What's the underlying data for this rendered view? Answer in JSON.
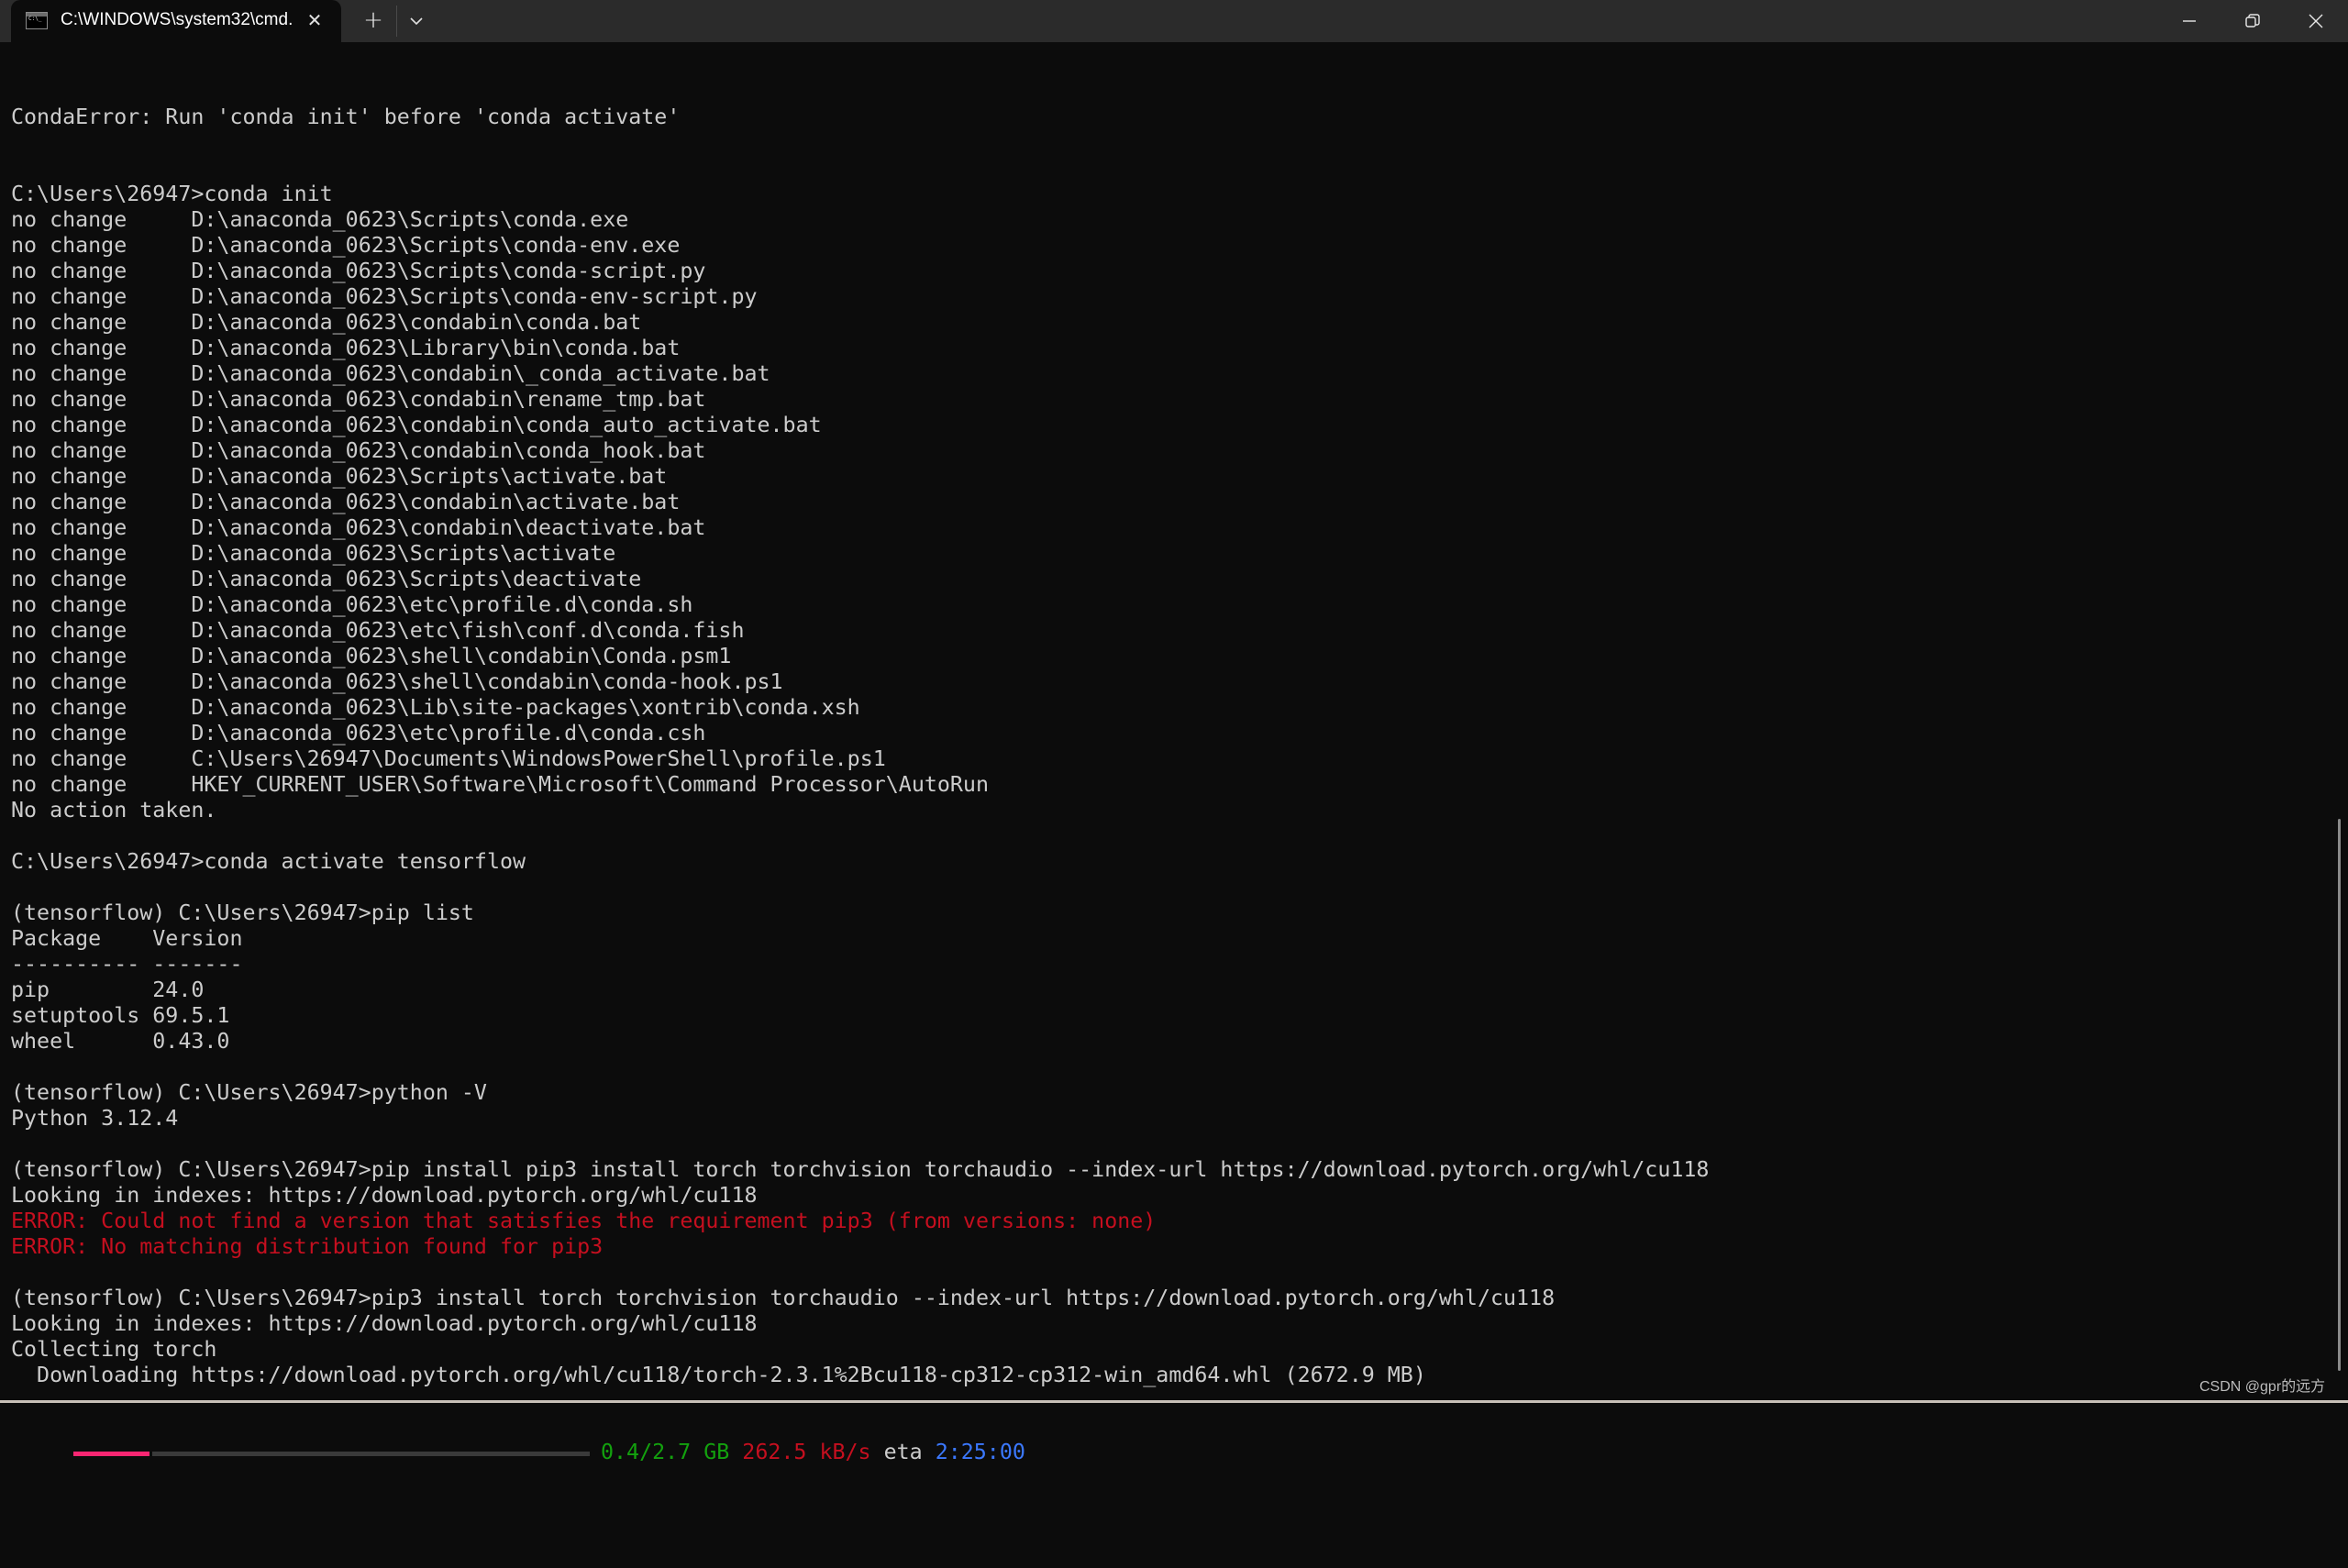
{
  "window": {
    "tab_title": "C:\\WINDOWS\\system32\\cmd.",
    "tab_close": "✕",
    "new_tab": "+",
    "tab_icon": "cmd-icon",
    "controls": [
      "minimize",
      "restore",
      "close"
    ]
  },
  "terminal": {
    "lines": [
      {
        "text": "CondaError: Run 'conda init' before 'conda activate'",
        "type": "normal"
      },
      {
        "text": "",
        "type": "normal"
      },
      {
        "text": "",
        "type": "normal"
      },
      {
        "text": "C:\\Users\\26947>conda init",
        "type": "normal"
      },
      {
        "text": "no change     D:\\anaconda_0623\\Scripts\\conda.exe",
        "type": "normal"
      },
      {
        "text": "no change     D:\\anaconda_0623\\Scripts\\conda-env.exe",
        "type": "normal"
      },
      {
        "text": "no change     D:\\anaconda_0623\\Scripts\\conda-script.py",
        "type": "normal"
      },
      {
        "text": "no change     D:\\anaconda_0623\\Scripts\\conda-env-script.py",
        "type": "normal"
      },
      {
        "text": "no change     D:\\anaconda_0623\\condabin\\conda.bat",
        "type": "normal"
      },
      {
        "text": "no change     D:\\anaconda_0623\\Library\\bin\\conda.bat",
        "type": "normal"
      },
      {
        "text": "no change     D:\\anaconda_0623\\condabin\\_conda_activate.bat",
        "type": "normal"
      },
      {
        "text": "no change     D:\\anaconda_0623\\condabin\\rename_tmp.bat",
        "type": "normal"
      },
      {
        "text": "no change     D:\\anaconda_0623\\condabin\\conda_auto_activate.bat",
        "type": "normal"
      },
      {
        "text": "no change     D:\\anaconda_0623\\condabin\\conda_hook.bat",
        "type": "normal"
      },
      {
        "text": "no change     D:\\anaconda_0623\\Scripts\\activate.bat",
        "type": "normal"
      },
      {
        "text": "no change     D:\\anaconda_0623\\condabin\\activate.bat",
        "type": "normal"
      },
      {
        "text": "no change     D:\\anaconda_0623\\condabin\\deactivate.bat",
        "type": "normal"
      },
      {
        "text": "no change     D:\\anaconda_0623\\Scripts\\activate",
        "type": "normal"
      },
      {
        "text": "no change     D:\\anaconda_0623\\Scripts\\deactivate",
        "type": "normal"
      },
      {
        "text": "no change     D:\\anaconda_0623\\etc\\profile.d\\conda.sh",
        "type": "normal"
      },
      {
        "text": "no change     D:\\anaconda_0623\\etc\\fish\\conf.d\\conda.fish",
        "type": "normal"
      },
      {
        "text": "no change     D:\\anaconda_0623\\shell\\condabin\\Conda.psm1",
        "type": "normal"
      },
      {
        "text": "no change     D:\\anaconda_0623\\shell\\condabin\\conda-hook.ps1",
        "type": "normal"
      },
      {
        "text": "no change     D:\\anaconda_0623\\Lib\\site-packages\\xontrib\\conda.xsh",
        "type": "normal"
      },
      {
        "text": "no change     D:\\anaconda_0623\\etc\\profile.d\\conda.csh",
        "type": "normal"
      },
      {
        "text": "no change     C:\\Users\\26947\\Documents\\WindowsPowerShell\\profile.ps1",
        "type": "normal"
      },
      {
        "text": "no change     HKEY_CURRENT_USER\\Software\\Microsoft\\Command Processor\\AutoRun",
        "type": "normal"
      },
      {
        "text": "No action taken.",
        "type": "normal"
      },
      {
        "text": "",
        "type": "normal"
      },
      {
        "text": "C:\\Users\\26947>conda activate tensorflow",
        "type": "normal"
      },
      {
        "text": "",
        "type": "normal"
      },
      {
        "text": "(tensorflow) C:\\Users\\26947>pip list",
        "type": "normal"
      },
      {
        "text": "Package    Version",
        "type": "normal"
      },
      {
        "text": "---------- -------",
        "type": "normal"
      },
      {
        "text": "pip        24.0",
        "type": "normal"
      },
      {
        "text": "setuptools 69.5.1",
        "type": "normal"
      },
      {
        "text": "wheel      0.43.0",
        "type": "normal"
      },
      {
        "text": "",
        "type": "normal"
      },
      {
        "text": "(tensorflow) C:\\Users\\26947>python -V",
        "type": "normal"
      },
      {
        "text": "Python 3.12.4",
        "type": "normal"
      },
      {
        "text": "",
        "type": "normal"
      },
      {
        "text": "(tensorflow) C:\\Users\\26947>pip install pip3 install torch torchvision torchaudio --index-url https://download.pytorch.org/whl/cu118",
        "type": "normal"
      },
      {
        "text": "Looking in indexes: https://download.pytorch.org/whl/cu118",
        "type": "normal"
      },
      {
        "text": "ERROR: Could not find a version that satisfies the requirement pip3 (from versions: none)",
        "type": "error"
      },
      {
        "text": "ERROR: No matching distribution found for pip3",
        "type": "error"
      },
      {
        "text": "",
        "type": "normal"
      },
      {
        "text": "(tensorflow) C:\\Users\\26947>pip3 install torch torchvision torchaudio --index-url https://download.pytorch.org/whl/cu118",
        "type": "normal"
      },
      {
        "text": "Looking in indexes: https://download.pytorch.org/whl/cu118",
        "type": "normal"
      },
      {
        "text": "Collecting torch",
        "type": "normal"
      },
      {
        "text": "  Downloading https://download.pytorch.org/whl/cu118/torch-2.3.1%2Bcu118-cp312-cp312-win_amd64.whl (2672.9 MB)",
        "type": "normal"
      }
    ],
    "progress": {
      "fraction": 0.148,
      "downloaded": "0.4/2.7 GB",
      "speed": "262.5 kB/s",
      "eta_label": "eta",
      "eta": "2:25:00"
    }
  },
  "colors": {
    "background": "#0c0c0c",
    "foreground": "#cccccc",
    "error": "#c50f1f",
    "progress_fill": "#f92672",
    "progress_size": "#13a10e",
    "progress_speed": "#c50f1f",
    "progress_eta": "#3b78ff"
  },
  "watermark": "CSDN @gpr的远方"
}
